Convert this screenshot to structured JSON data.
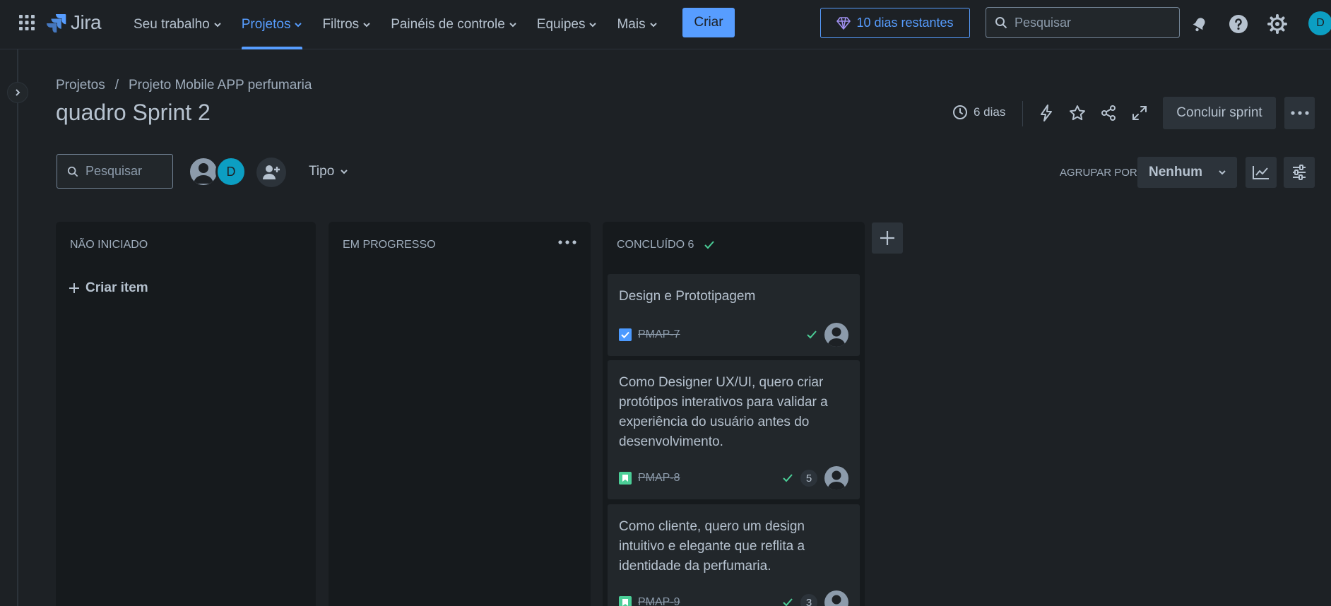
{
  "topnav": {
    "logo_text": "Jira",
    "items": [
      {
        "label": "Seu trabalho"
      },
      {
        "label": "Projetos"
      },
      {
        "label": "Filtros"
      },
      {
        "label": "Painéis de controle"
      },
      {
        "label": "Equipes"
      },
      {
        "label": "Mais"
      }
    ],
    "active_item": "Projetos",
    "create_label": "Criar",
    "trial_label": "10 dias restantes",
    "search_placeholder": "Pesquisar",
    "avatar_initial": "D"
  },
  "header": {
    "breadcrumb": [
      "Projetos",
      "Projeto Mobile APP perfumaria"
    ],
    "breadcrumb_separator": "/",
    "title": "quadro Sprint 2",
    "days_left": "6 dias",
    "conclude_label": "Concluir sprint"
  },
  "filters": {
    "search_placeholder": "Pesquisar",
    "avatar_initial": "D",
    "type_label": "Tipo",
    "group_by_label": "AGRUPAR POR",
    "group_by_value": "Nenhum"
  },
  "columns": [
    {
      "title": "NÃO INICIADO",
      "create_label": "Criar item"
    },
    {
      "title": "EM PROGRESSO"
    },
    {
      "title": "CONCLUÍDO 6"
    }
  ],
  "cards": [
    {
      "text": "Design e Prototipagem",
      "key": "PMAP-7",
      "type": "task",
      "count": ""
    },
    {
      "text": "Como Designer UX/UI, quero criar protótipos interativos para validar a experiência do usuário antes do desenvolvimento.",
      "key": "PMAP-8",
      "type": "story",
      "count": "5"
    },
    {
      "text": "Como cliente, quero um design intuitivo e elegante que reflita a identidade da perfumaria.",
      "key": "PMAP-9",
      "type": "story",
      "count": "3"
    }
  ],
  "colors": {
    "background": "#1d2125",
    "column": "#161a1d",
    "card": "#22272b",
    "accent": "#579dff",
    "done_green": "#4bce97",
    "task_blue": "#4c9aff",
    "story_green": "#4bce97"
  }
}
